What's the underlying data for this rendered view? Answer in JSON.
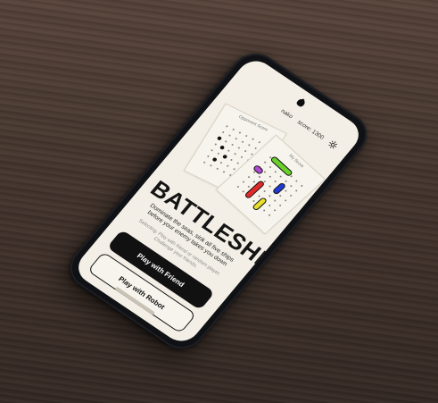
{
  "status": {
    "user": "nako",
    "score_label": "score:",
    "score_value": "1300"
  },
  "boards": {
    "left_caption": "Opponent Score",
    "right_caption": "My Score"
  },
  "title": "BATTLESHIP",
  "subtitle": "Dominate the seas, sink all five ships before your enemy takes you down",
  "small_text": "Selecting. Play with friend or random player. Challenge your friends.",
  "buttons": {
    "play_friend": "Play with Friend",
    "play_robot": "Play with Robot"
  },
  "colors": {
    "screen_bg": "#f3efe6",
    "ink": "#111111",
    "ship_green": "#6ad12b",
    "ship_yellow": "#e7df2b",
    "ship_red": "#e12a2a",
    "ship_blue": "#1f3bd3",
    "ship_purple": "#b04bd6"
  }
}
